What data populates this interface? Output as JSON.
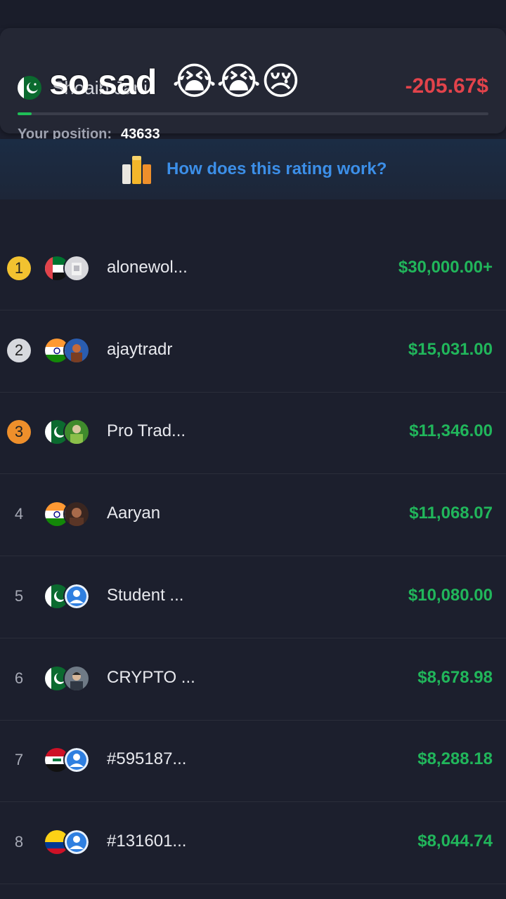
{
  "header": {
    "overlay_text": "so sad",
    "emojis": "😭😭😢",
    "username": "Shoaib Jani",
    "profit": "-205.67$",
    "position_label": "Your position:",
    "position_value": "43633",
    "progress_fraction": 0.03
  },
  "rating_link": {
    "text": "How does this rating work?"
  },
  "leaderboard": [
    {
      "rank": "1",
      "name": "alonewol...",
      "amount": "$30,000.00+",
      "flag": "uae",
      "avatar": "photo-light"
    },
    {
      "rank": "2",
      "name": "ajaytradr",
      "amount": "$15,031.00",
      "flag": "india",
      "avatar": "photo-blue"
    },
    {
      "rank": "3",
      "name": "Pro Trad...",
      "amount": "$11,346.00",
      "flag": "pakistan",
      "avatar": "photo-green"
    },
    {
      "rank": "4",
      "name": "Aaryan",
      "amount": "$11,068.07",
      "flag": "india",
      "avatar": "photo-dark"
    },
    {
      "rank": "5",
      "name": "Student ...",
      "amount": "$10,080.00",
      "flag": "pakistan",
      "avatar": "default-user"
    },
    {
      "rank": "6",
      "name": "CRYPTO ...",
      "amount": "$8,678.98",
      "flag": "pakistan",
      "avatar": "photo-gray"
    },
    {
      "rank": "7",
      "name": "#595187...",
      "amount": "$8,288.18",
      "flag": "iraq",
      "avatar": "default-user"
    },
    {
      "rank": "8",
      "name": "#131601...",
      "amount": "$8,044.74",
      "flag": "colombia",
      "avatar": "default-user"
    }
  ],
  "colors": {
    "gold": "#f2c230",
    "silver": "#d7d9de",
    "bronze": "#ee8f2b",
    "positive": "#21b65b",
    "negative": "#e2434b",
    "link": "#3c8fe8"
  }
}
